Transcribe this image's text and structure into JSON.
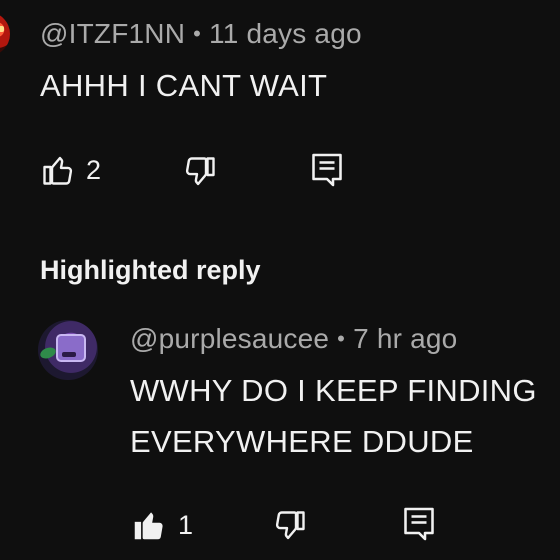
{
  "comment": {
    "author": "@ITZF1NN",
    "separator": "•",
    "time": "11 days ago",
    "text": "AHHH I CANT WAIT",
    "likes": "2"
  },
  "highlighted_section": {
    "title": "Highlighted reply"
  },
  "reply": {
    "author": "@purplesaucee",
    "separator": "•",
    "time": "7 hr ago",
    "text_line1": "WWHY DO I KEEP FINDING",
    "text_line2": "EVERYWHERE DDUDE",
    "likes": "1",
    "liked": true
  },
  "icons": {
    "like": "thumbs-up-icon",
    "dislike": "thumbs-down-icon",
    "reply": "reply-icon"
  },
  "colors": {
    "background": "#0f0f0f",
    "text_primary": "#f1f1f1",
    "text_secondary": "#aaaaaa"
  }
}
